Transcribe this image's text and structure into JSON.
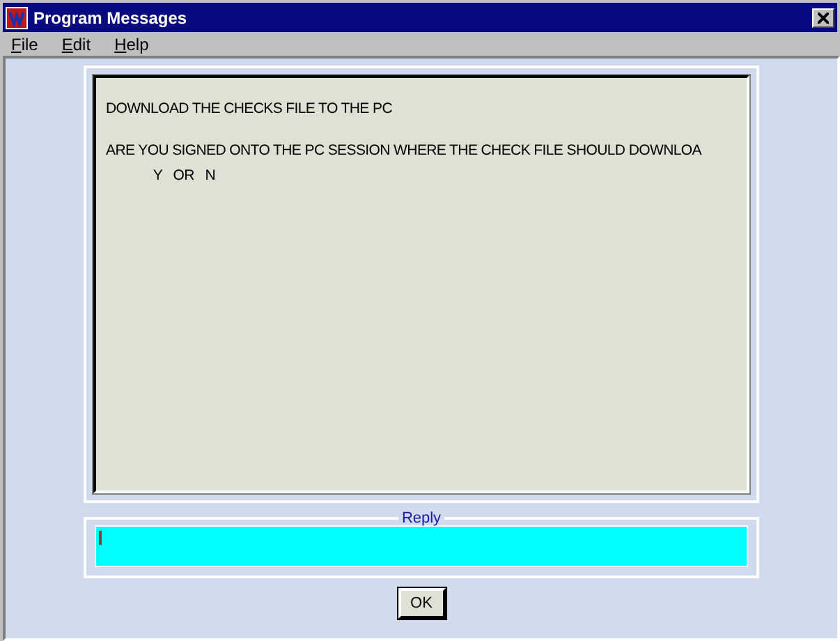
{
  "window": {
    "title": "Program Messages"
  },
  "menu": [
    "File",
    "Edit",
    "Help"
  ],
  "message": {
    "paragraphs": [
      [
        "DOWNLOAD THE CHECKS FILE TO THE PC"
      ],
      [
        "ARE YOU SIGNED ONTO THE PC SESSION WHERE THE CHECK FILE SHOULD DOWNLOA",
        "             Y   OR   N"
      ]
    ]
  },
  "reply": {
    "legend": "Reply"
  },
  "buttons": [
    "OK"
  ]
}
